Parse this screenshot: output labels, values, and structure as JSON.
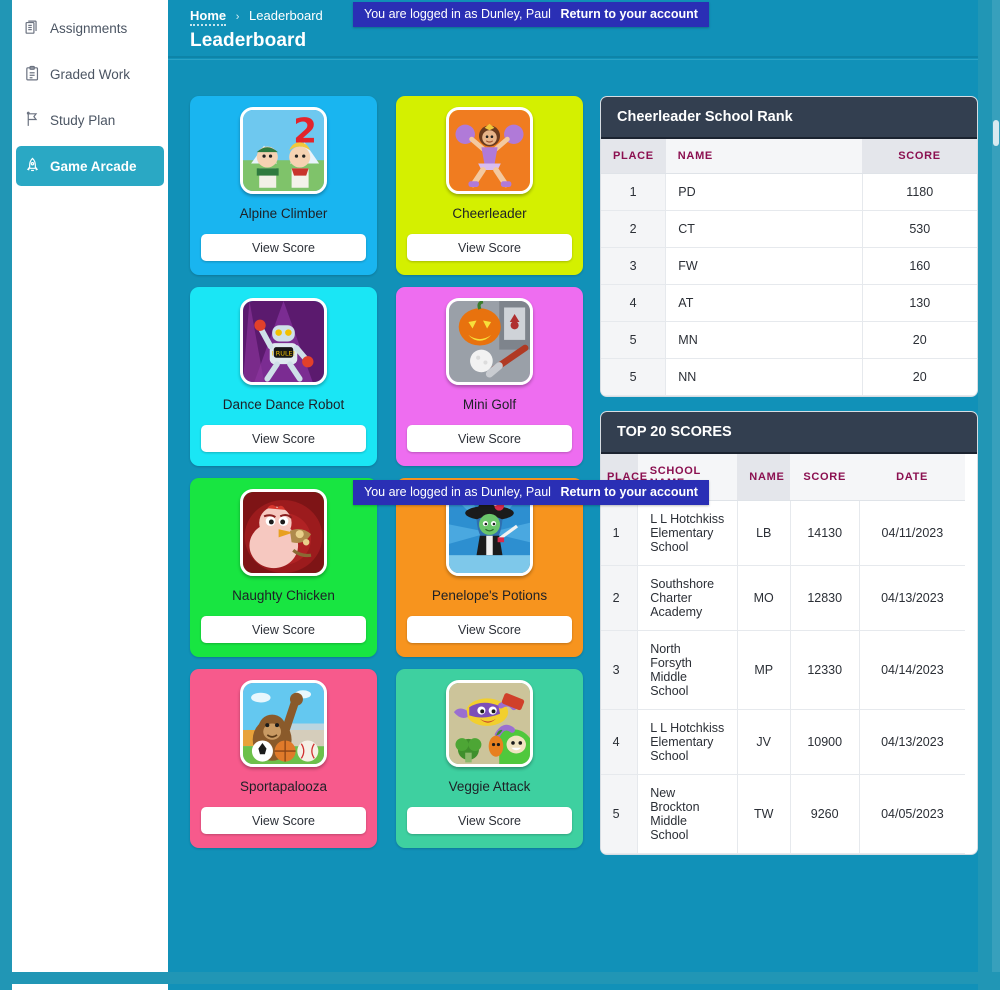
{
  "sidebar": {
    "items": [
      {
        "label": "Assignments",
        "icon": "documents-icon",
        "active": false
      },
      {
        "label": "Graded Work",
        "icon": "clipboard-icon",
        "active": false
      },
      {
        "label": "Study Plan",
        "icon": "bookmark-flag-icon",
        "active": false
      },
      {
        "label": "Game Arcade",
        "icon": "rocket-icon",
        "active": true
      }
    ]
  },
  "header": {
    "breadcrumb_home": "Home",
    "breadcrumb_separator": "›",
    "breadcrumb_current": "Leaderboard",
    "page_title": "Leaderboard"
  },
  "impersonation_banner": {
    "message": "You are logged in as Dunley, Paul",
    "link": "Return to your account",
    "background": "#2a2fb5"
  },
  "games": {
    "button_label": "View Score",
    "rows": [
      [
        {
          "title": "Alpine Climber",
          "color": "#19b5f0",
          "thumb": "alpine-climber-thumb"
        },
        {
          "title": "Cheerleader",
          "color": "#d4f000",
          "thumb": "cheerleader-thumb"
        }
      ],
      [
        {
          "title": "Dance Dance Robot",
          "color": "#1ae6f5",
          "thumb": "dance-dance-robot-thumb"
        },
        {
          "title": "Mini Golf",
          "color": "#ee6df0",
          "thumb": "mini-golf-thumb"
        }
      ],
      [
        {
          "title": "Naughty Chicken",
          "color": "#18e541",
          "thumb": "naughty-chicken-thumb"
        },
        {
          "title": "Penelope's Potions",
          "color": "#f7941e",
          "thumb": "penelopes-potions-thumb"
        }
      ],
      [
        {
          "title": "Sportapalooza",
          "color": "#f75a8c",
          "thumb": "sportapalooza-thumb"
        },
        {
          "title": "Veggie Attack",
          "color": "#3ed0a0",
          "thumb": "veggie-attack-thumb"
        }
      ]
    ]
  },
  "cheer_rank": {
    "title": "Cheerleader School Rank",
    "columns": [
      "PLACE",
      "NAME",
      "SCORE"
    ],
    "rows": [
      {
        "place": "1",
        "name": "PD",
        "score": "1180"
      },
      {
        "place": "2",
        "name": "CT",
        "score": "530"
      },
      {
        "place": "3",
        "name": "FW",
        "score": "160"
      },
      {
        "place": "4",
        "name": "AT",
        "score": "130"
      },
      {
        "place": "5",
        "name": "MN",
        "score": "20"
      },
      {
        "place": "5",
        "name": "NN",
        "score": "20"
      }
    ]
  },
  "top_scores": {
    "title": "TOP 20 SCORES",
    "columns": [
      "PLACE",
      "SCHOOL NAME",
      "NAME",
      "SCORE",
      "DATE"
    ],
    "rows": [
      {
        "place": "1",
        "school": "L L Hotchkiss Elementary School",
        "name": "LB",
        "score": "14130",
        "date": "04/11/2023"
      },
      {
        "place": "2",
        "school": "Southshore Charter Academy",
        "name": "MO",
        "score": "12830",
        "date": "04/13/2023"
      },
      {
        "place": "3",
        "school": "North Forsyth Middle School",
        "name": "MP",
        "score": "12330",
        "date": "04/14/2023"
      },
      {
        "place": "4",
        "school": "L L Hotchkiss Elementary School",
        "name": "JV",
        "score": "10900",
        "date": "04/13/2023"
      },
      {
        "place": "5",
        "school": "New Brockton Middle School",
        "name": "TW",
        "score": "9260",
        "date": "04/05/2023"
      }
    ]
  },
  "theme": {
    "page_bg": "#2196b5",
    "main_bg": "#1191b8",
    "panel_head_bg": "#333f50",
    "table_header_color": "#8b1050",
    "sidebar_active_bg": "#2aa8c4"
  }
}
